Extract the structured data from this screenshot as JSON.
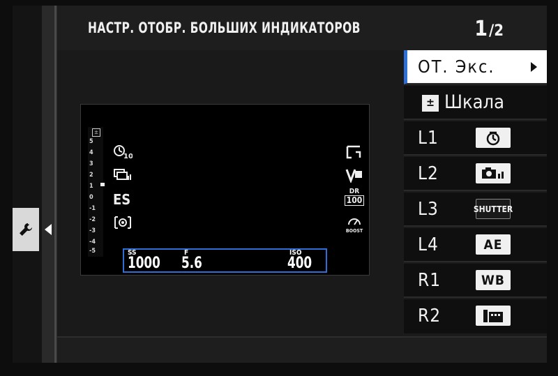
{
  "header": {
    "title": "НАСТР. ОТОБР. БОЛЬШИХ ИНДИКАТОРОВ",
    "page_current": "1",
    "page_total": "/2"
  },
  "sidebar": {
    "active_tab": "wrench-icon"
  },
  "preview": {
    "scale_ticks": [
      "5",
      "4",
      "3",
      "2",
      "1",
      "0",
      "-1",
      "-2",
      "-3",
      "-4",
      "-5"
    ],
    "left_icons": [
      "self-timer-10-icon",
      "continuous-shooting-icon",
      "ES",
      "metering-icon"
    ],
    "es_label": "ES",
    "right_icons": [
      "film-simulation-icon",
      "white-balance-icon",
      "dynamic-range-icon",
      "boost-icon"
    ],
    "dr_label": "DR",
    "dr_value": "100",
    "boost_label": "BOOST",
    "ss_label": "SS",
    "ss_value": "1000",
    "f_label": "F",
    "f_value": "5.6",
    "iso_label": "ISO",
    "iso_value": "400",
    "selection_color": "#2d6fd6"
  },
  "menu": {
    "items": [
      {
        "label": "ОТ. Экс.",
        "selected": true
      },
      {
        "label": "Шкала",
        "icon": "exposure-compensation-icon"
      },
      {
        "label": "L1",
        "badge": "self-timer-icon"
      },
      {
        "label": "L2",
        "badge": "continuous-shooting-icon"
      },
      {
        "label": "L3",
        "badge": "SHUTTER"
      },
      {
        "label": "L4",
        "badge": "AE"
      },
      {
        "label": "R1",
        "badge": "WB"
      },
      {
        "label": "R2",
        "badge": "film-icon"
      }
    ],
    "accent": "#2d6fd6"
  }
}
